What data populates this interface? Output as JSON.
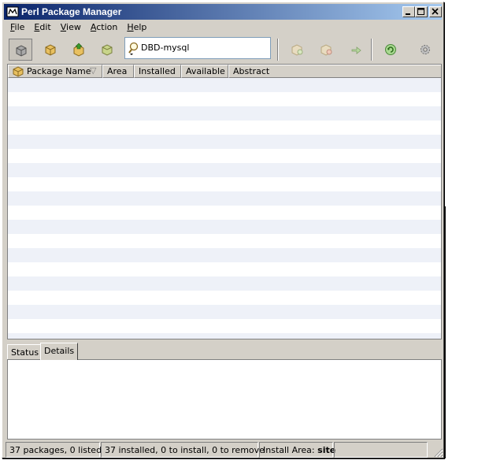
{
  "window": {
    "title": "Perl Package Manager"
  },
  "title_buttons": {
    "minimize": "_",
    "maximize": "□",
    "close": "×"
  },
  "menu": [
    {
      "label": "File",
      "u": "F",
      "rest": "ile"
    },
    {
      "label": "Edit",
      "u": "E",
      "rest": "dit"
    },
    {
      "label": "View",
      "u": "V",
      "rest": "iew"
    },
    {
      "label": "Action",
      "u": "A",
      "rest": "ction"
    },
    {
      "label": "Help",
      "u": "H",
      "rest": "elp"
    }
  ],
  "toolbar": {
    "search": {
      "value": "DBD-mysql",
      "placeholder": ""
    },
    "icons": [
      "view-all-packages-icon",
      "view-installed-icon",
      "view-upgradable-icon",
      "view-packages-to-install-icon",
      "mark-for-install-icon",
      "mark-for-remove-icon",
      "mark-for-upgrade-icon",
      "run-marked-actions-icon",
      "preferences-icon"
    ]
  },
  "table": {
    "columns": [
      "Package Name",
      "Area",
      "Installed",
      "Available",
      "Abstract"
    ],
    "sort_indicator": "▽",
    "rows": []
  },
  "tabs": [
    {
      "label": "Status",
      "active": false
    },
    {
      "label": "Details",
      "active": true
    }
  ],
  "status": {
    "packages": "37  packages,  0  listed",
    "counts": "37  installed,  0  to install,  0  to remove",
    "area_label": "Install Area:",
    "area_value": "site"
  },
  "colors": {
    "title_start": "#0a246a",
    "title_end": "#a6caf0",
    "face": "#d4d0c8",
    "row_alt": "#eef1f8"
  }
}
